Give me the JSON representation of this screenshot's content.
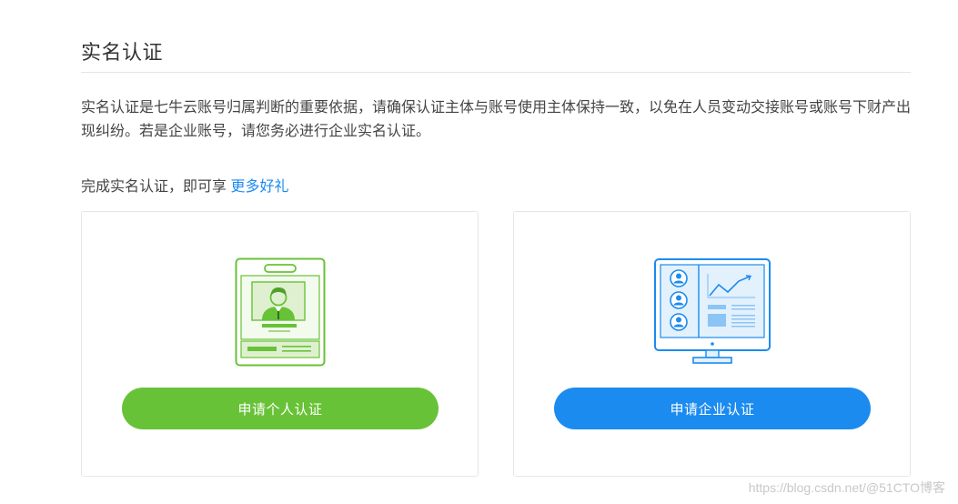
{
  "header": {
    "title": "实名认证"
  },
  "intro": {
    "description": "实名认证是七牛云账号归属判断的重要依据，请确保认证主体与账号使用主体保持一致，以免在人员变动交接账号或账号下财产出现纠纷。若是企业账号，请您务必进行企业实名认证。"
  },
  "reward": {
    "prefix": "完成实名认证，即可享 ",
    "link_label": "更多好礼"
  },
  "cards": {
    "personal": {
      "icon": "id-badge-icon",
      "button_label": "申请个人认证",
      "accent_color": "#68c237"
    },
    "enterprise": {
      "icon": "monitor-dashboard-icon",
      "button_label": "申请企业认证",
      "accent_color": "#1c8bf0"
    }
  },
  "watermark": {
    "text": "https://blog.csdn.net/@51CTO博客"
  }
}
